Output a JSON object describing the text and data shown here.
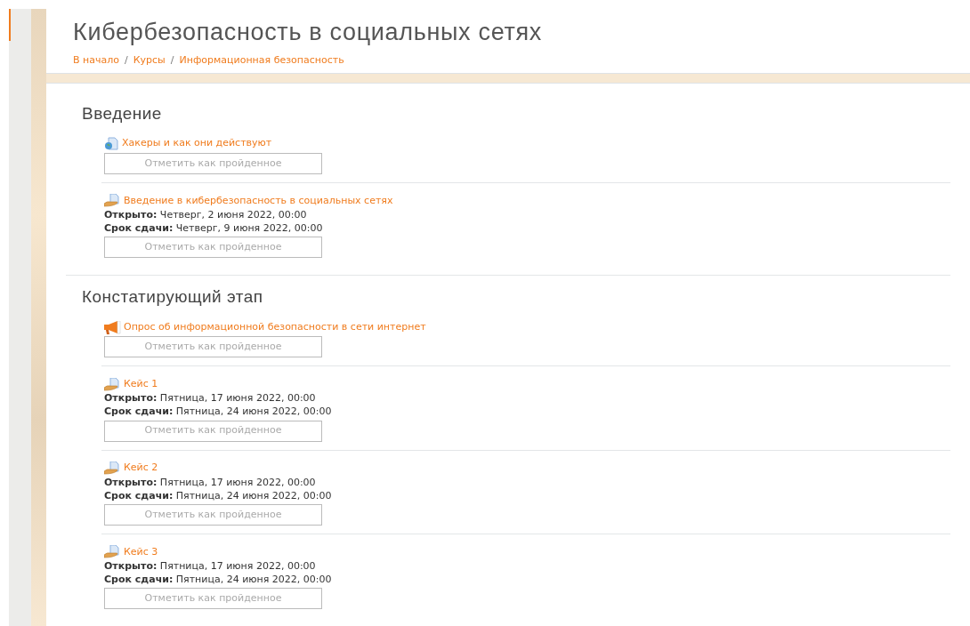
{
  "header": {
    "title": "Кибербезопасность в социальных сетях",
    "breadcrumb": [
      "В начало",
      "Курсы",
      "Информационная безопасность"
    ],
    "separator": "/"
  },
  "sections": [
    {
      "title": "Введение",
      "activities": [
        {
          "kind": "url",
          "name": "Хакеры и как они действуют",
          "button": "Отметить как пройденное"
        },
        {
          "kind": "assign",
          "name": "Введение в кибербезопасность в социальных сетях",
          "dates": [
            "**Открыто:** Четверг, 2 июня 2022, 00:00",
            "**Срок сдачи:** Четверг, 9 июня 2022, 00:00"
          ],
          "button": "Отметить как пройденное"
        }
      ]
    },
    {
      "title": "Констатирующий этап",
      "activities": [
        {
          "kind": "feedback",
          "name": "Опрос об информационной безопасности в сети интернет",
          "button": "Отметить как пройденное"
        },
        {
          "kind": "assign",
          "name": "Кейс 1",
          "dates": [
            "**Открыто:** Пятница, 17 июня 2022, 00:00",
            "**Срок сдачи:** Пятница, 24 июня 2022, 00:00"
          ],
          "button": "Отметить как пройденное"
        },
        {
          "kind": "assign",
          "name": "Кейс 2",
          "dates": [
            "**Открыто:** Пятница, 17 июня 2022, 00:00",
            "**Срок сдачи:** Пятница, 24 июня 2022, 00:00"
          ],
          "button": "Отметить как пройденное"
        },
        {
          "kind": "assign",
          "name": "Кейс 3",
          "dates": [
            "**Открыто:** Пятница, 17 июня 2022, 00:00",
            "**Срок сдачи:** Пятница, 24 июня 2022, 00:00"
          ],
          "button": "Отметить как пройденное"
        }
      ]
    }
  ]
}
